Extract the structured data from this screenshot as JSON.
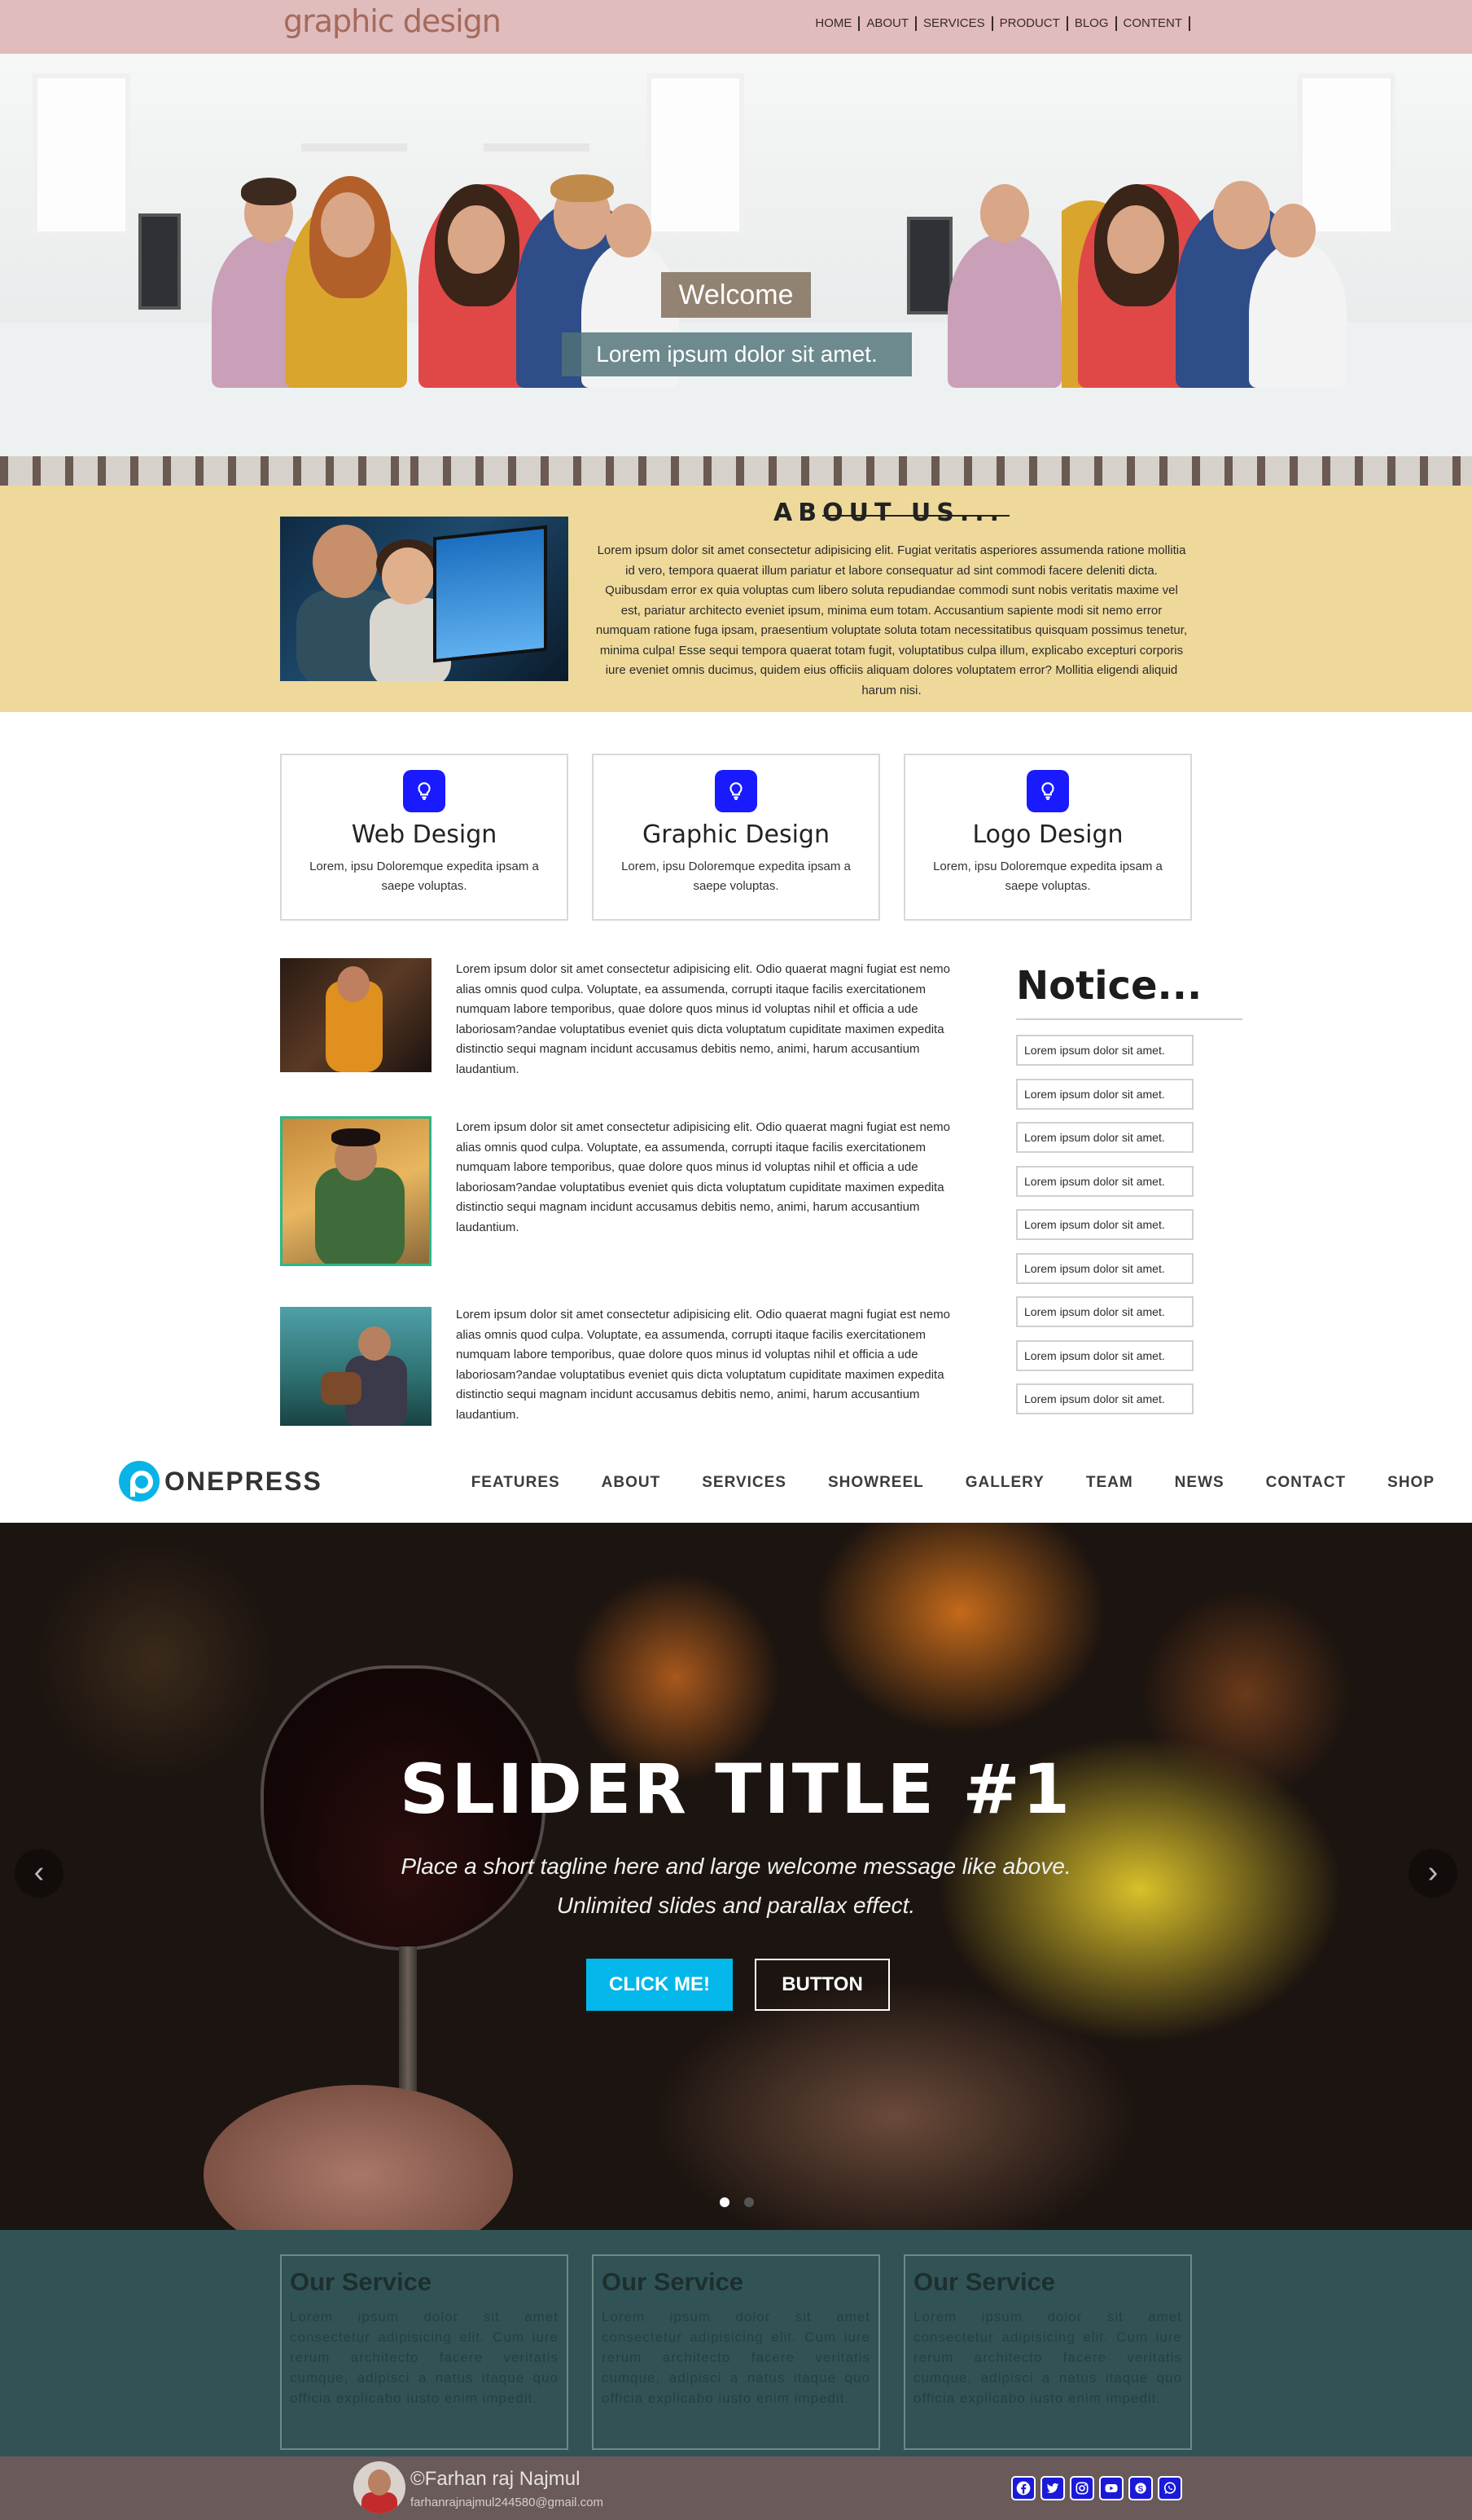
{
  "header": {
    "logo": "graphic design",
    "nav": [
      "HOME",
      "ABOUT",
      "SERVICES",
      "PRODUCT",
      "BLOG",
      "CONTENT"
    ]
  },
  "hero": {
    "welcome": "Welcome",
    "subtitle": "Lorem ipsum dolor sit amet."
  },
  "about": {
    "title": "ABOUT US...",
    "text": "Lorem ipsum dolor sit amet consectetur adipisicing elit. Fugiat veritatis asperiores assumenda ratione mollitia id vero, tempora quaerat illum pariatur et labore consequatur ad sint commodi facere deleniti dicta. Quibusdam error ex quia voluptas cum libero soluta repudiandae commodi sunt nobis veritatis maxime vel est, pariatur architecto eveniet ipsum, minima eum totam. Accusantium sapiente modi sit nemo error numquam ratione fuga ipsam, praesentium voluptate soluta totam necessitatibus quisquam possimus tenetur, minima culpa! Esse sequi tempora quaerat totam fugit, voluptatibus culpa illum, explicabo excepturi corporis iure eveniet omnis ducimus, quidem eius officiis aliquam dolores voluptatem error? Mollitia eligendi aliquid harum nisi."
  },
  "cards": [
    {
      "title": "Web Design",
      "text": "Lorem, ipsu Doloremque expedita ipsam a saepe voluptas.",
      "icon": "lightbulb-icon"
    },
    {
      "title": "Graphic Design",
      "text": "Lorem, ipsu Doloremque expedita ipsam a saepe voluptas.",
      "icon": "lightbulb-icon"
    },
    {
      "title": "Logo Design",
      "text": "Lorem, ipsu Doloremque expedita ipsam a saepe voluptas.",
      "icon": "lightbulb-icon"
    }
  ],
  "posts": [
    {
      "text": "Lorem ipsum dolor sit amet consectetur adipisicing elit. Odio quaerat magni fugiat est nemo alias omnis quod culpa. Voluptate, ea assumenda, corrupti itaque facilis exercitationem numquam labore temporibus, quae dolore quos minus id voluptas nihil et officia a ude laboriosam?andae voluptatibus eveniet quis dicta voluptatum cupiditate maximen expedita distinctio sequi magnam incidunt accusamus debitis nemo, animi, harum accusantium laudantium."
    },
    {
      "text": "Lorem ipsum dolor sit amet consectetur adipisicing elit. Odio quaerat magni fugiat est nemo alias omnis quod culpa. Voluptate, ea assumenda, corrupti itaque facilis exercitationem numquam labore temporibus, quae dolore quos minus id voluptas nihil et officia a ude laboriosam?andae voluptatibus eveniet quis dicta voluptatum cupiditate maximen expedita distinctio sequi magnam incidunt accusamus debitis nemo, animi, harum accusantium laudantium."
    },
    {
      "text": "Lorem ipsum dolor sit amet consectetur adipisicing elit. Odio quaerat magni fugiat est nemo alias omnis quod culpa. Voluptate, ea assumenda, corrupti itaque facilis exercitationem numquam labore temporibus, quae dolore quos minus id voluptas nihil et officia a ude laboriosam?andae voluptatibus eveniet quis dicta voluptatum cupiditate maximen expedita distinctio sequi magnam incidunt accusamus debitis nemo, animi, harum accusantium laudantium."
    }
  ],
  "notice": {
    "title": "Notice...",
    "items": [
      "Lorem ipsum dolor sit amet.",
      "Lorem ipsum dolor sit amet.",
      "Lorem ipsum dolor sit amet.",
      "Lorem ipsum dolor sit amet.",
      "Lorem ipsum dolor sit amet.",
      "Lorem ipsum dolor sit amet.",
      "Lorem ipsum dolor sit amet.",
      "Lorem ipsum dolor sit amet.",
      "Lorem ipsum dolor sit amet."
    ]
  },
  "onepress": {
    "logo_text": "ONEPRESS",
    "nav": [
      "FEATURES",
      "ABOUT",
      "SERVICES",
      "SHOWREEL",
      "GALLERY",
      "TEAM",
      "NEWS",
      "CONTACT",
      "SHOP"
    ]
  },
  "slider": {
    "title": "SLIDER TITLE #1",
    "tagline_line1": "Place a short tagline here and large welcome message like above.",
    "tagline_line2": "Unlimited slides and parallax effect.",
    "primary_button": "CLICK ME!",
    "secondary_button": "BUTTON",
    "prev_arrow": "‹",
    "next_arrow": "›",
    "active_slide": 1,
    "slide_count": 2
  },
  "services": [
    {
      "title": "Our Service",
      "text": "Lorem ipsum dolor sit amet consectetur adipisicing elit. Cum iure rerum architecto facere veritatis cumque, adipisci a natus itaque quo officia explicabo iusto enim impedit."
    },
    {
      "title": "Our Service",
      "text": "Lorem ipsum dolor sit amet consectetur adipisicing elit. Cum iure rerum architecto facere veritatis cumque, adipisci a natus itaque quo officia explicabo iusto enim impedit."
    },
    {
      "title": "Our Service",
      "text": "Lorem ipsum dolor sit amet consectetur adipisicing elit. Cum iure rerum architecto facere veritatis cumque, adipisci a natus itaque quo officia explicabo iusto enim impedit."
    }
  ],
  "footer": {
    "name": "©Farhan raj Najmul",
    "email": "farhanrajnajmul244580@gmail.com",
    "socials": [
      "facebook-icon",
      "twitter-icon",
      "instagram-icon",
      "youtube-icon",
      "skype-icon",
      "whatsapp-icon"
    ]
  },
  "colors": {
    "topbar": "#e0bcbc",
    "about_bg": "#eed99b",
    "card_icon": "#1a1aff",
    "onepress_accent": "#03b7ea",
    "service_bg": "#315355",
    "footer_bg": "#6a5a5a"
  }
}
